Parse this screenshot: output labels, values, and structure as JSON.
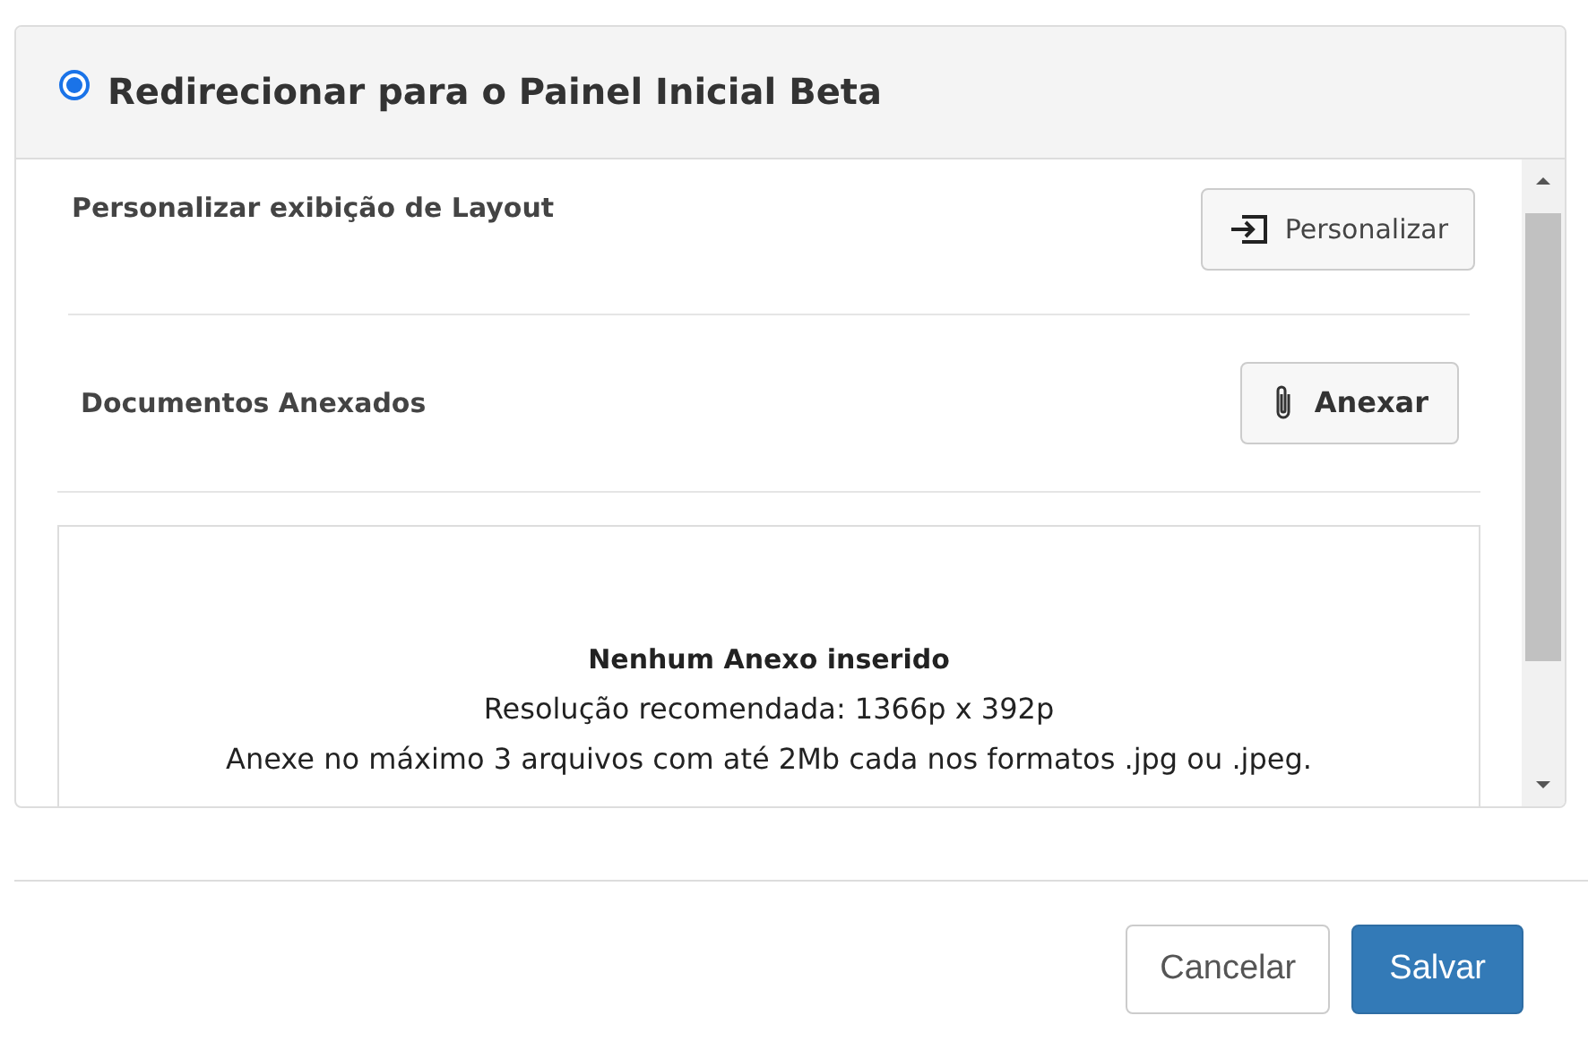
{
  "header": {
    "title": "Redirecionar para o Painel Inicial Beta",
    "selected": true
  },
  "layout_section": {
    "label": "Personalizar exibição de Layout",
    "button": "Personalizar"
  },
  "documents_section": {
    "label": "Documentos Anexados",
    "button": "Anexar"
  },
  "empty_state": {
    "title": "Nenhum Anexo inserido",
    "resolution": "Resolução recomendada: 1366p x 392p",
    "hint": "Anexe no máximo 3 arquivos com até 2Mb cada nos formatos .jpg ou .jpeg."
  },
  "buttons": [
    {
      "label": "Cancelar",
      "kind": "secondary"
    },
    {
      "label": "Salvar",
      "kind": "primary"
    }
  ]
}
